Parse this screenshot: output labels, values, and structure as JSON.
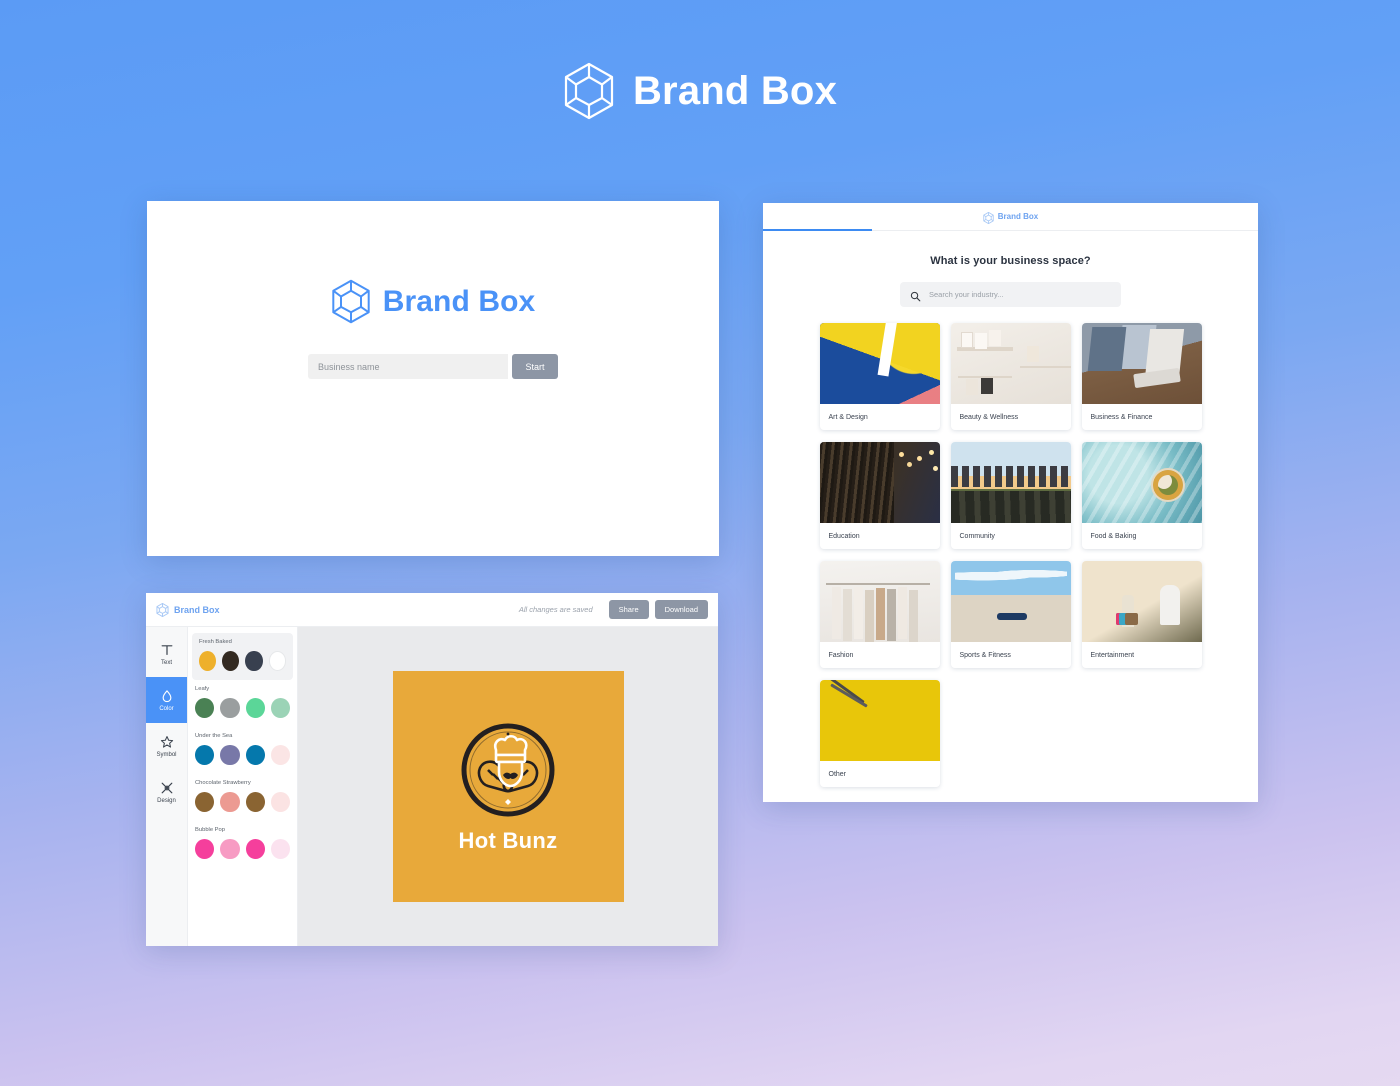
{
  "brand": {
    "name": "Brand Box",
    "logo_icon": "cube-hexagon-icon",
    "header_color": "#ffffff",
    "accent_blue": "#4a92f7",
    "light_blue": "#6ea3f0"
  },
  "background": {
    "top_color": "#5b9bf5",
    "bottom_color": "#e5d9f1"
  },
  "landing": {
    "logo_icon": "cube-hexagon-icon",
    "wordmark": "Brand Box",
    "business_name_value": "",
    "business_name_placeholder": "Business name",
    "start_label": "Start"
  },
  "industry": {
    "topbar_logo_icon": "cube-hexagon-icon",
    "topbar_wordmark": "Brand Box",
    "progress_percent": 22,
    "heading": "What is your business space?",
    "search_icon": "search-icon",
    "search_value": "",
    "search_placeholder": "Search your industry...",
    "categories": [
      {
        "label": "Art & Design",
        "thumb_class": "th-art"
      },
      {
        "label": "Beauty & Wellness",
        "thumb_class": "th-beauty"
      },
      {
        "label": "Business & Finance",
        "thumb_class": "th-business"
      },
      {
        "label": "Education",
        "thumb_class": "th-education"
      },
      {
        "label": "Community",
        "thumb_class": "th-community"
      },
      {
        "label": "Food & Baking",
        "thumb_class": "th-food"
      },
      {
        "label": "Fashion",
        "thumb_class": "th-fashion"
      },
      {
        "label": "Sports & Fitness",
        "thumb_class": "th-sports"
      },
      {
        "label": "Entertainment",
        "thumb_class": "th-ent"
      },
      {
        "label": "Other",
        "thumb_class": "th-other"
      }
    ]
  },
  "editor": {
    "topbar_logo_icon": "cube-hexagon-icon",
    "topbar_wordmark": "Brand Box",
    "save_status": "All changes are saved",
    "share_label": "Share",
    "download_label": "Download",
    "tools": [
      {
        "label": "Text",
        "icon": "text-t-icon",
        "active": false
      },
      {
        "label": "Color",
        "icon": "droplet-icon",
        "active": true
      },
      {
        "label": "Symbol",
        "icon": "star-icon",
        "active": false
      },
      {
        "label": "Design",
        "icon": "shapes-icon",
        "active": false
      }
    ],
    "palettes": [
      {
        "name": "Fresh Baked",
        "selected": true,
        "colors": [
          "#eeb02b",
          "#332a21",
          "#38404f",
          "#ffffff"
        ]
      },
      {
        "name": "Leafy",
        "selected": false,
        "colors": [
          "#4a8154",
          "#9a9e9f",
          "#5bd698",
          "#9bd3b6"
        ]
      },
      {
        "name": "Under the Sea",
        "selected": false,
        "colors": [
          "#0578ac",
          "#7878a8",
          "#0578ac",
          "#fbe5e5"
        ]
      },
      {
        "name": "Chocolate Strawberry",
        "selected": false,
        "colors": [
          "#8a6432",
          "#ec9a92",
          "#8a6432",
          "#fbe3e3"
        ]
      },
      {
        "name": "Bubble Pop",
        "selected": false,
        "colors": [
          "#f53f9c",
          "#f79bc3",
          "#f53f9c",
          "#fbe2ef"
        ]
      }
    ],
    "logo": {
      "business_name": "Hot Bunz",
      "background_color": "#e8a93a",
      "emblem_color": "#231f20",
      "text_color": "#ffffff",
      "symbol": "baker-bread-icon"
    }
  }
}
